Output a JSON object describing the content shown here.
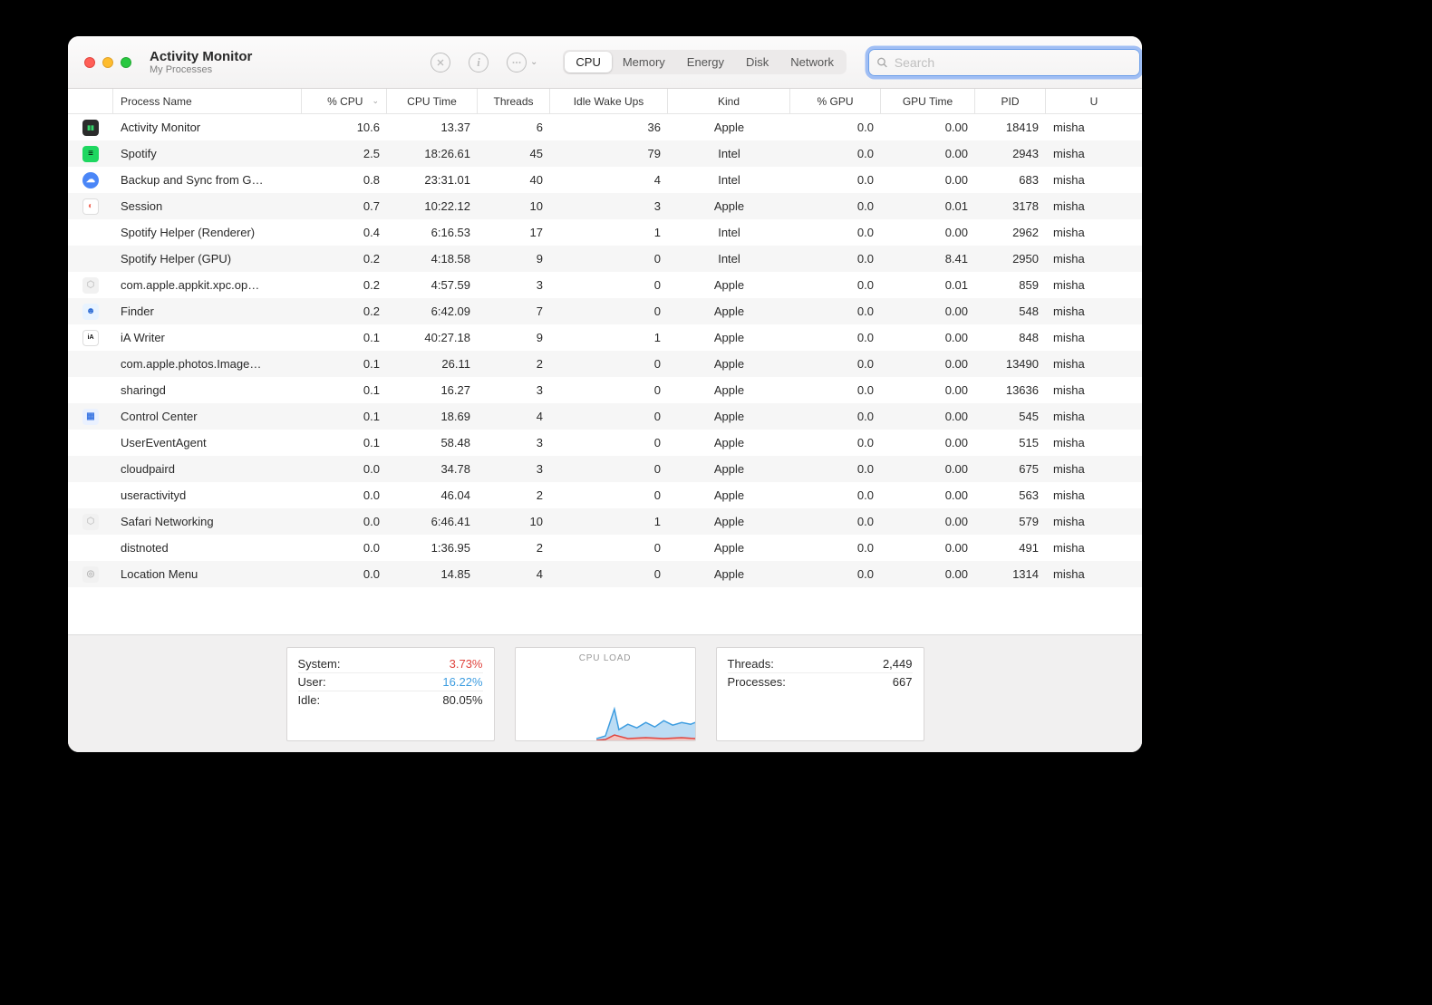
{
  "header": {
    "title": "Activity Monitor",
    "subtitle": "My Processes",
    "tabs": [
      "CPU",
      "Memory",
      "Energy",
      "Disk",
      "Network"
    ],
    "active_tab": "CPU",
    "search_placeholder": "Search"
  },
  "columns": {
    "name": "Process Name",
    "cpu": "% CPU",
    "time": "CPU Time",
    "threads": "Threads",
    "wakeups": "Idle Wake Ups",
    "kind": "Kind",
    "gpup": "% GPU",
    "gput": "GPU Time",
    "pid": "PID",
    "user": "U"
  },
  "rows": [
    {
      "icon_bg": "#2b2b2b",
      "icon_fg": "#35d46a",
      "glyph": "▮▮",
      "name": "Activity Monitor",
      "cpu": "10.6",
      "time": "13.37",
      "threads": "6",
      "wakeups": "36",
      "kind": "Apple",
      "gpup": "0.0",
      "gput": "0.00",
      "pid": "18419",
      "user": "misha"
    },
    {
      "icon_bg": "#1ed760",
      "icon_fg": "#000000",
      "glyph": "≡",
      "name": "Spotify",
      "cpu": "2.5",
      "time": "18:26.61",
      "threads": "45",
      "wakeups": "79",
      "kind": "Intel",
      "gpup": "0.0",
      "gput": "0.00",
      "pid": "2943",
      "user": "misha"
    },
    {
      "icon_bg": "#4a86f7",
      "icon_fg": "#ffffff",
      "glyph": "☁",
      "round": true,
      "name": "Backup and Sync from G…",
      "cpu": "0.8",
      "time": "23:31.01",
      "threads": "40",
      "wakeups": "4",
      "kind": "Intel",
      "gpup": "0.0",
      "gput": "0.00",
      "pid": "683",
      "user": "misha"
    },
    {
      "icon_bg": "#ffffff",
      "icon_fg": "#f06a5a",
      "glyph": "◐",
      "border": true,
      "name": "Session",
      "cpu": "0.7",
      "time": "10:22.12",
      "threads": "10",
      "wakeups": "3",
      "kind": "Apple",
      "gpup": "0.0",
      "gput": "0.01",
      "pid": "3178",
      "user": "misha"
    },
    {
      "icon_bg": "",
      "icon_fg": "",
      "glyph": "",
      "name": "Spotify Helper (Renderer)",
      "cpu": "0.4",
      "time": "6:16.53",
      "threads": "17",
      "wakeups": "1",
      "kind": "Intel",
      "gpup": "0.0",
      "gput": "0.00",
      "pid": "2962",
      "user": "misha"
    },
    {
      "icon_bg": "",
      "icon_fg": "",
      "glyph": "",
      "name": "Spotify Helper (GPU)",
      "cpu": "0.2",
      "time": "4:18.58",
      "threads": "9",
      "wakeups": "0",
      "kind": "Intel",
      "gpup": "0.0",
      "gput": "8.41",
      "pid": "2950",
      "user": "misha"
    },
    {
      "icon_bg": "#f1f1f1",
      "icon_fg": "#c9c9c9",
      "glyph": "⬡",
      "name": "com.apple.appkit.xpc.op…",
      "cpu": "0.2",
      "time": "4:57.59",
      "threads": "3",
      "wakeups": "0",
      "kind": "Apple",
      "gpup": "0.0",
      "gput": "0.01",
      "pid": "859",
      "user": "misha"
    },
    {
      "icon_bg": "#e8f3ff",
      "icon_fg": "#2f6dd5",
      "glyph": "☻",
      "name": "Finder",
      "cpu": "0.2",
      "time": "6:42.09",
      "threads": "7",
      "wakeups": "0",
      "kind": "Apple",
      "gpup": "0.0",
      "gput": "0.00",
      "pid": "548",
      "user": "misha"
    },
    {
      "icon_bg": "#ffffff",
      "icon_fg": "#111111",
      "glyph": "iA",
      "border": true,
      "name": "iA Writer",
      "cpu": "0.1",
      "time": "40:27.18",
      "threads": "9",
      "wakeups": "1",
      "kind": "Apple",
      "gpup": "0.0",
      "gput": "0.00",
      "pid": "848",
      "user": "misha"
    },
    {
      "icon_bg": "",
      "icon_fg": "",
      "glyph": "",
      "name": "com.apple.photos.Image…",
      "cpu": "0.1",
      "time": "26.11",
      "threads": "2",
      "wakeups": "0",
      "kind": "Apple",
      "gpup": "0.0",
      "gput": "0.00",
      "pid": "13490",
      "user": "misha"
    },
    {
      "icon_bg": "",
      "icon_fg": "",
      "glyph": "",
      "name": "sharingd",
      "cpu": "0.1",
      "time": "16.27",
      "threads": "3",
      "wakeups": "0",
      "kind": "Apple",
      "gpup": "0.0",
      "gput": "0.00",
      "pid": "13636",
      "user": "misha"
    },
    {
      "icon_bg": "#eaf1ff",
      "icon_fg": "#3d78e3",
      "glyph": "▦",
      "name": "Control Center",
      "cpu": "0.1",
      "time": "18.69",
      "threads": "4",
      "wakeups": "0",
      "kind": "Apple",
      "gpup": "0.0",
      "gput": "0.00",
      "pid": "545",
      "user": "misha"
    },
    {
      "icon_bg": "",
      "icon_fg": "",
      "glyph": "",
      "name": "UserEventAgent",
      "cpu": "0.1",
      "time": "58.48",
      "threads": "3",
      "wakeups": "0",
      "kind": "Apple",
      "gpup": "0.0",
      "gput": "0.00",
      "pid": "515",
      "user": "misha"
    },
    {
      "icon_bg": "",
      "icon_fg": "",
      "glyph": "",
      "name": "cloudpaird",
      "cpu": "0.0",
      "time": "34.78",
      "threads": "3",
      "wakeups": "0",
      "kind": "Apple",
      "gpup": "0.0",
      "gput": "0.00",
      "pid": "675",
      "user": "misha"
    },
    {
      "icon_bg": "",
      "icon_fg": "",
      "glyph": "",
      "name": "useractivityd",
      "cpu": "0.0",
      "time": "46.04",
      "threads": "2",
      "wakeups": "0",
      "kind": "Apple",
      "gpup": "0.0",
      "gput": "0.00",
      "pid": "563",
      "user": "misha"
    },
    {
      "icon_bg": "#f1f1f1",
      "icon_fg": "#c9c9c9",
      "glyph": "⬡",
      "name": "Safari Networking",
      "cpu": "0.0",
      "time": "6:46.41",
      "threads": "10",
      "wakeups": "1",
      "kind": "Apple",
      "gpup": "0.0",
      "gput": "0.00",
      "pid": "579",
      "user": "misha"
    },
    {
      "icon_bg": "",
      "icon_fg": "",
      "glyph": "",
      "name": "distnoted",
      "cpu": "0.0",
      "time": "1:36.95",
      "threads": "2",
      "wakeups": "0",
      "kind": "Apple",
      "gpup": "0.0",
      "gput": "0.00",
      "pid": "491",
      "user": "misha"
    },
    {
      "icon_bg": "#f1f1f1",
      "icon_fg": "#b8b8b8",
      "glyph": "◎",
      "name": "Location Menu",
      "cpu": "0.0",
      "time": "14.85",
      "threads": "4",
      "wakeups": "0",
      "kind": "Apple",
      "gpup": "0.0",
      "gput": "0.00",
      "pid": "1314",
      "user": "misha"
    }
  ],
  "footer": {
    "stats": {
      "system_label": "System:",
      "system_value": "3.73%",
      "user_label": "User:",
      "user_value": "16.22%",
      "idle_label": "Idle:",
      "idle_value": "80.05%"
    },
    "chart_title": "CPU LOAD",
    "counts": {
      "threads_label": "Threads:",
      "threads_value": "2,449",
      "processes_label": "Processes:",
      "processes_value": "667"
    }
  }
}
